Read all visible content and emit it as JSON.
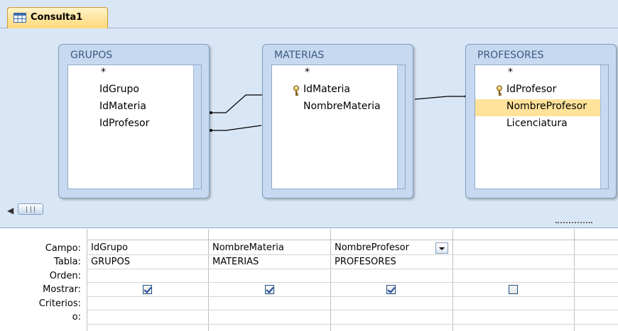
{
  "tab": {
    "label": "Consulta1",
    "icon": "query-icon"
  },
  "tables": [
    {
      "name": "GRUPOS",
      "fields": [
        "*",
        "IdGrupo",
        "IdMateria",
        "IdProfesor"
      ],
      "key": ""
    },
    {
      "name": "MATERIAS",
      "fields": [
        "*",
        "IdMateria",
        "NombreMateria"
      ],
      "key": "IdMateria"
    },
    {
      "name": "PROFESORES",
      "fields": [
        "*",
        "IdProfesor",
        "NombreProfesor",
        "Licenciatura"
      ],
      "key": "IdProfesor",
      "selected": "NombreProfesor"
    }
  ],
  "grid": {
    "row_labels": [
      "Campo:",
      "Tabla:",
      "Orden:",
      "Mostrar:",
      "Criterios:",
      "o:"
    ],
    "columns": [
      {
        "campo": "IdGrupo",
        "tabla": "GRUPOS",
        "mostrar": true
      },
      {
        "campo": "NombreMateria",
        "tabla": "MATERIAS",
        "mostrar": true
      },
      {
        "campo": "NombreProfesor",
        "tabla": "PROFESORES",
        "mostrar": true,
        "dropdown": true
      },
      {
        "campo": "",
        "tabla": "",
        "mostrar": false
      }
    ]
  },
  "colors": {
    "accent_tab": "#ffd87a",
    "design_bg": "#d9e6f5",
    "table_header": "#c6d9f1",
    "selected_field": "#ffe39a"
  }
}
